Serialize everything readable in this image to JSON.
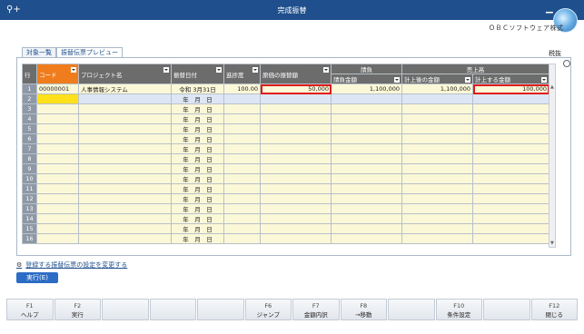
{
  "window": {
    "title": "完成振替",
    "search_glyph": "⚲+",
    "min_glyph": "▁"
  },
  "company": "ＯＢＣソフトウェア株式",
  "tabs": [
    {
      "label": "対象一覧"
    },
    {
      "label": "振替伝票プレビュー"
    }
  ],
  "settings_label": "税抜",
  "table": {
    "headers": {
      "row": "行",
      "code": "コード",
      "project": "プロジェクト名",
      "date": "振替日付",
      "progress": "進捗度",
      "cost": "原価の振替額",
      "contract": "請負",
      "contract_amount": "請負金額",
      "sales": "売上高",
      "booked": "計上後の金額",
      "to_book": "計上する金額"
    },
    "rows": [
      {
        "n": "1",
        "code": "00000001",
        "project": "人事情報システム",
        "date": "令和 3月31日",
        "progress": "100.00",
        "cost": "50,000",
        "contract": "1,100,000",
        "booked": "1,100,000",
        "to_book": "100,000"
      },
      {
        "n": "2",
        "code": "",
        "project": "",
        "date": "年　月　日",
        "progress": "",
        "cost": "",
        "contract": "",
        "booked": "",
        "to_book": ""
      },
      {
        "n": "3",
        "code": "",
        "project": "",
        "date": "年　月　日",
        "progress": "",
        "cost": "",
        "contract": "",
        "booked": "",
        "to_book": ""
      },
      {
        "n": "4",
        "code": "",
        "project": "",
        "date": "年　月　日",
        "progress": "",
        "cost": "",
        "contract": "",
        "booked": "",
        "to_book": ""
      },
      {
        "n": "5",
        "code": "",
        "project": "",
        "date": "年　月　日",
        "progress": "",
        "cost": "",
        "contract": "",
        "booked": "",
        "to_book": ""
      },
      {
        "n": "6",
        "code": "",
        "project": "",
        "date": "年　月　日",
        "progress": "",
        "cost": "",
        "contract": "",
        "booked": "",
        "to_book": ""
      },
      {
        "n": "7",
        "code": "",
        "project": "",
        "date": "年　月　日",
        "progress": "",
        "cost": "",
        "contract": "",
        "booked": "",
        "to_book": ""
      },
      {
        "n": "8",
        "code": "",
        "project": "",
        "date": "年　月　日",
        "progress": "",
        "cost": "",
        "contract": "",
        "booked": "",
        "to_book": ""
      },
      {
        "n": "9",
        "code": "",
        "project": "",
        "date": "年　月　日",
        "progress": "",
        "cost": "",
        "contract": "",
        "booked": "",
        "to_book": ""
      },
      {
        "n": "10",
        "code": "",
        "project": "",
        "date": "年　月　日",
        "progress": "",
        "cost": "",
        "contract": "",
        "booked": "",
        "to_book": ""
      },
      {
        "n": "11",
        "code": "",
        "project": "",
        "date": "年　月　日",
        "progress": "",
        "cost": "",
        "contract": "",
        "booked": "",
        "to_book": ""
      },
      {
        "n": "12",
        "code": "",
        "project": "",
        "date": "年　月　日",
        "progress": "",
        "cost": "",
        "contract": "",
        "booked": "",
        "to_book": ""
      },
      {
        "n": "13",
        "code": "",
        "project": "",
        "date": "年　月　日",
        "progress": "",
        "cost": "",
        "contract": "",
        "booked": "",
        "to_book": ""
      },
      {
        "n": "14",
        "code": "",
        "project": "",
        "date": "年　月　日",
        "progress": "",
        "cost": "",
        "contract": "",
        "booked": "",
        "to_book": ""
      },
      {
        "n": "15",
        "code": "",
        "project": "",
        "date": "年　月　日",
        "progress": "",
        "cost": "",
        "contract": "",
        "booked": "",
        "to_book": ""
      },
      {
        "n": "16",
        "code": "",
        "project": "",
        "date": "年　月　日",
        "progress": "",
        "cost": "",
        "contract": "",
        "booked": "",
        "to_book": ""
      }
    ]
  },
  "footer": {
    "link_label": "登録する振替伝票の設定を変更する",
    "gear_glyph": "⚙",
    "run_button": "実行(E)"
  },
  "fkeys": [
    {
      "key": "F1",
      "label": "ヘルプ"
    },
    {
      "key": "F2",
      "label": "実行"
    },
    {
      "key": "",
      "label": ""
    },
    {
      "key": "",
      "label": ""
    },
    {
      "key": "",
      "label": ""
    },
    {
      "key": "F6",
      "label": "ジャンプ"
    },
    {
      "key": "F7",
      "label": "金額内訳"
    },
    {
      "key": "F8",
      "label": "→移動"
    },
    {
      "key": "",
      "label": ""
    },
    {
      "key": "F10",
      "label": "条件設定"
    },
    {
      "key": "",
      "label": ""
    },
    {
      "key": "F12",
      "label": "閉じる"
    }
  ],
  "colors": {
    "titlebar": "#1f4f8c",
    "code_header": "#ef7d1d",
    "highlight": "#e11b1b",
    "selected_cell": "#ffe01a"
  }
}
